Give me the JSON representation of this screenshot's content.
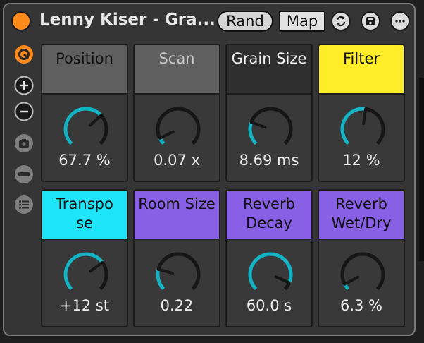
{
  "title": "Lenny Kiser - Gra...",
  "buttons": {
    "rand": "Rand",
    "map": "Map"
  },
  "colors": {
    "power": "#ff8a1c",
    "knob_arc": "#14b3c4",
    "header_gray": "#5f5f5f",
    "header_dark": "#2f2f2f",
    "header_yellow": "#ffed2a",
    "header_cyan": "#1ee6f8",
    "header_purple": "#8860e6"
  },
  "macros": [
    {
      "name": "Position",
      "value": "67.7 %",
      "level": 0.677,
      "header": "#5f5f5f",
      "text": "#111111"
    },
    {
      "name": "Scan",
      "value": "0.07 x",
      "level": 0.07,
      "header": "#5f5f5f",
      "text": "#c8c8c8"
    },
    {
      "name": "Grain Size",
      "value": "8.69 ms",
      "level": 0.24,
      "header": "#2f2f2f",
      "text": "#f0f0f0"
    },
    {
      "name": "Filter",
      "value": "12 %",
      "level": 0.53,
      "header": "#ffed2a",
      "text": "#111111"
    },
    {
      "name": "Transpo se",
      "value": "+12 st",
      "level": 0.7,
      "header": "#1ee6f8",
      "text": "#111111"
    },
    {
      "name": "Room Size",
      "value": "0.22",
      "level": 0.22,
      "header": "#8860e6",
      "text": "#111111"
    },
    {
      "name": "Reverb Decay",
      "value": "60.0 s",
      "level": 0.92,
      "header": "#8860e6",
      "text": "#111111"
    },
    {
      "name": "Reverb Wet/Dry",
      "value": "6.3 %",
      "level": 0.063,
      "header": "#8860e6",
      "text": "#111111"
    }
  ],
  "side_icons": [
    "device-icon",
    "add-icon",
    "remove-icon",
    "snapshot-icon",
    "minus-bar-icon",
    "list-icon"
  ]
}
